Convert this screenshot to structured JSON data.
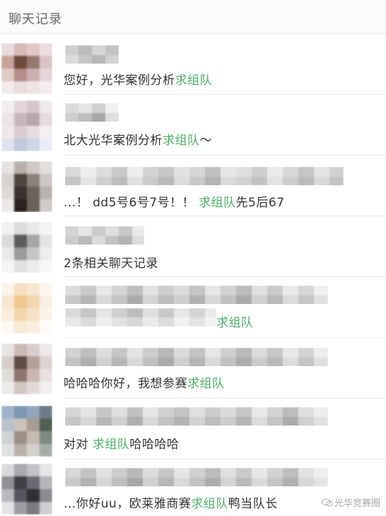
{
  "header": {
    "title": "聊天记录"
  },
  "items": [
    {
      "segments": [
        {
          "text": "您好，光华案例分析",
          "kw": false
        },
        {
          "text": "求组队",
          "kw": true
        }
      ]
    },
    {
      "segments": [
        {
          "text": "北大光华案例分析",
          "kw": false
        },
        {
          "text": "求组队",
          "kw": true
        },
        {
          "text": "～",
          "kw": false
        }
      ]
    },
    {
      "segments": [
        {
          "text": "...！ dd5号6号7号！！ ",
          "kw": false
        },
        {
          "text": "求组队",
          "kw": true
        },
        {
          "text": "先5后67",
          "kw": false
        }
      ]
    },
    {
      "segments": [
        {
          "text": "2条相关聊天记录",
          "kw": false
        }
      ]
    },
    {
      "segments": [
        {
          "text": "求组队",
          "kw": true
        }
      ]
    },
    {
      "segments": [
        {
          "text": "哈哈哈你好，我想参赛",
          "kw": false
        },
        {
          "text": "求组队",
          "kw": true
        }
      ]
    },
    {
      "segments": [
        {
          "text": "对对 ",
          "kw": false
        },
        {
          "text": "求组队",
          "kw": true
        },
        {
          "text": "哈哈哈哈",
          "kw": false
        }
      ]
    },
    {
      "segments": [
        {
          "text": "...你好uu，欧莱雅商赛",
          "kw": false
        },
        {
          "text": "求组队",
          "kw": true
        },
        {
          "text": "鸭当队长",
          "kw": false
        }
      ]
    }
  ],
  "watermark": {
    "text": "光华竞赛圈"
  },
  "colors": {
    "keyword": "#4caf67",
    "text": "#333333",
    "header_text": "#666666"
  }
}
